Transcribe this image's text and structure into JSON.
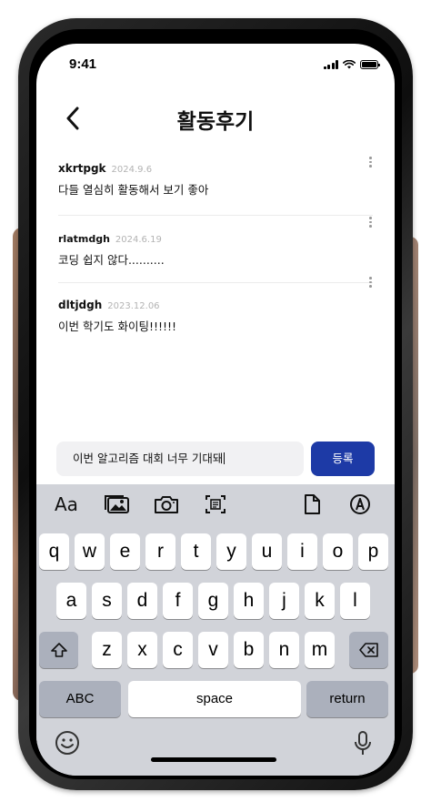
{
  "status_bar": {
    "time": "9:41"
  },
  "header": {
    "title": "활동후기"
  },
  "reviews": [
    {
      "user": "xkrtpgk",
      "date": "2024.9.6",
      "text": "다들 열심히 활동해서 보기 좋아"
    },
    {
      "user": "rlatmdgh",
      "date": "2024.6.19",
      "text": "코딩 쉽지 않다.........."
    },
    {
      "user": "dltjdgh",
      "date": "2023.12.06",
      "text": "이번 학기도 화이팅!!!!!!"
    }
  ],
  "composer": {
    "value": "이번 알고리즘 대회 너무 기대돼",
    "submit_label": "등록"
  },
  "keyboard": {
    "toolbar": {
      "aa_label": "Aa"
    },
    "row1": [
      "q",
      "w",
      "e",
      "r",
      "t",
      "y",
      "u",
      "i",
      "o",
      "p"
    ],
    "row2": [
      "a",
      "s",
      "d",
      "f",
      "g",
      "h",
      "j",
      "k",
      "l"
    ],
    "row3": [
      "z",
      "x",
      "c",
      "v",
      "b",
      "n",
      "m"
    ],
    "abc_label": "ABC",
    "space_label": "space",
    "return_label": "return"
  },
  "colors": {
    "accent": "#1d3aa6",
    "keyboard_bg": "#d1d3d9",
    "dark_key": "#abb0bc"
  }
}
